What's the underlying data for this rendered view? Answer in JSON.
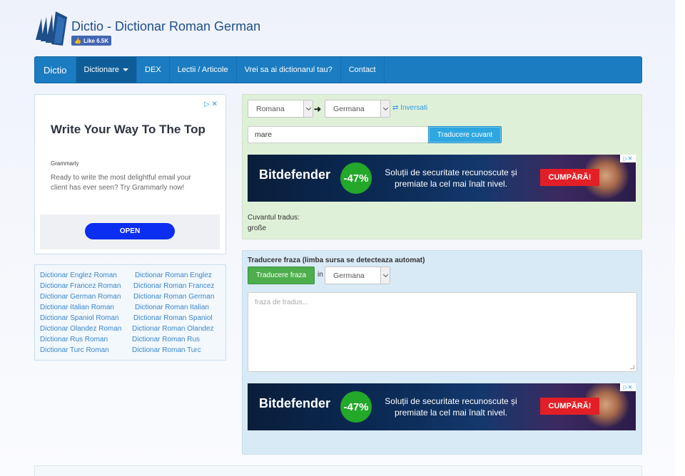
{
  "header": {
    "title": "Dictio - Dictionar Roman German",
    "fb_like": "Like 6.5K"
  },
  "navbar": {
    "brand": "Dictio",
    "items": [
      "Dictionare",
      "DEX",
      "Lectii / Articole",
      "Vrei sa ai dictionarul tau?",
      "Contact"
    ]
  },
  "ad_left": {
    "headline": "Write Your Way To The Top",
    "brand": "Grammarly",
    "description": "Ready to write the most delightful email your client has ever seen? Try Grammarly now!",
    "cta": "OPEN"
  },
  "links": [
    [
      "Dictionar Englez Roman",
      "Dictionar Roman Englez"
    ],
    [
      "Dictionar Francez Roman",
      "Dictionar Roman Francez"
    ],
    [
      "Dictionar German Roman",
      "Dictionar Roman German"
    ],
    [
      "Dictionar Italian Roman",
      "Dictionar Roman Italian"
    ],
    [
      "Dictionar Spaniol Roman",
      "Dictionar Roman Spaniol"
    ],
    [
      "Dictionar Olandez Roman",
      "Dictionar Roman Olandez"
    ],
    [
      "Dictionar Rus Roman",
      "Dictionar Roman Rus"
    ],
    [
      "Dictionar Turc Roman",
      "Dictionar Roman Turc"
    ]
  ],
  "word_translate": {
    "source_lang": "Romana",
    "target_lang": "Germana",
    "invert_label": "Inversati",
    "input_value": "mare",
    "button_label": "Traducere cuvant",
    "result_label": "Cuvantul tradus:",
    "result_value": "große"
  },
  "banner": {
    "brand": "Bitdefender",
    "discount": "-47%",
    "text": "Soluții de securitate recunoscute și premiate la cel mai înalt nivel.",
    "cta": "CUMPĂRĂ!"
  },
  "phrase_translate": {
    "title": "Traducere fraza (limba sursa se detecteaza automat)",
    "button_label": "Traducere fraza",
    "in_label": "in",
    "target_lang": "Germana",
    "placeholder": "fraza de tradus..."
  },
  "colors": {
    "navbar": "#1b7cc1",
    "word_panel": "#dff0d8",
    "phrase_panel": "#d9eaf7",
    "link": "#3a86c8"
  }
}
